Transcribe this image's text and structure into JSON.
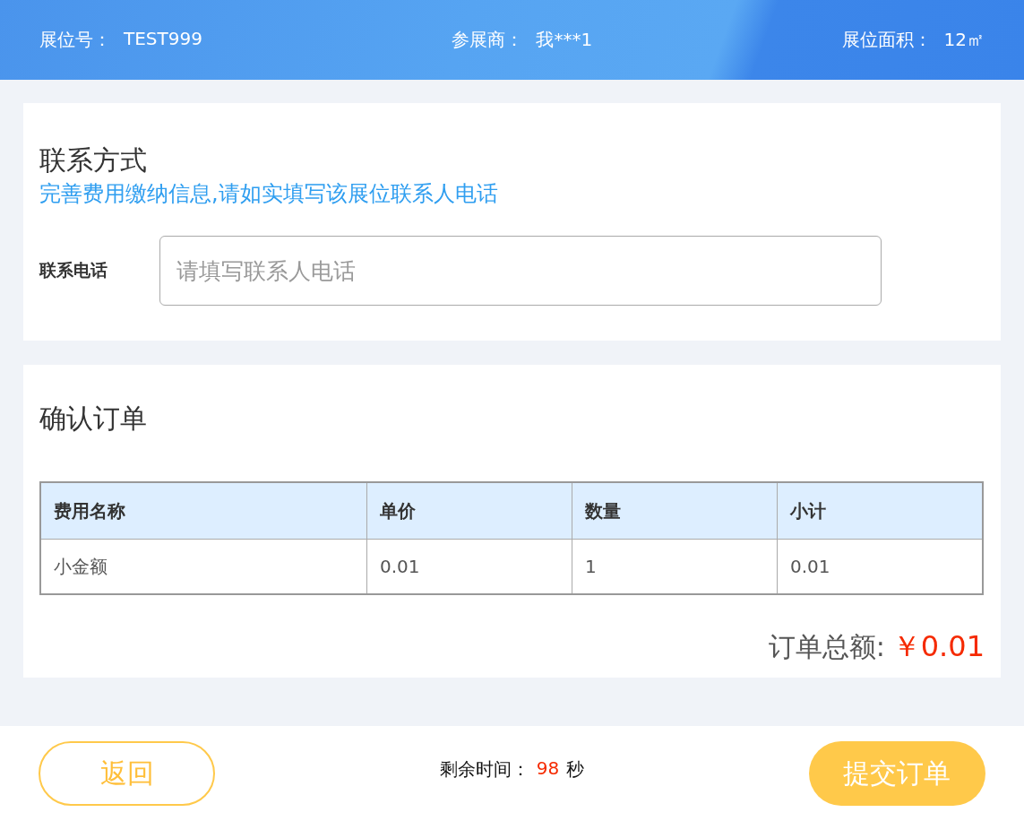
{
  "header": {
    "fields": [
      {
        "label": "展位号：",
        "value": "TEST999"
      },
      {
        "label": "参展商：",
        "value": "我***1"
      },
      {
        "label": "展位面积：",
        "value": "12㎡"
      }
    ]
  },
  "contact": {
    "title": "联系方式",
    "hint": "完善费用缴纳信息,请如实填写该展位联系人电话",
    "field_label": "联系电话",
    "placeholder": "请填写联系人电话"
  },
  "order": {
    "title": "确认订单",
    "columns": [
      "费用名称",
      "单价",
      "数量",
      "小计"
    ],
    "rows": [
      [
        "小金额",
        "0.01",
        "1",
        "0.01"
      ]
    ],
    "total_label": "订单总额:",
    "total_value": "￥0.01"
  },
  "footer": {
    "back_button": "返回",
    "timer_label": "剩余时间：",
    "timer_value": "98",
    "timer_unit": "秒",
    "submit_button": "提交订单"
  }
}
